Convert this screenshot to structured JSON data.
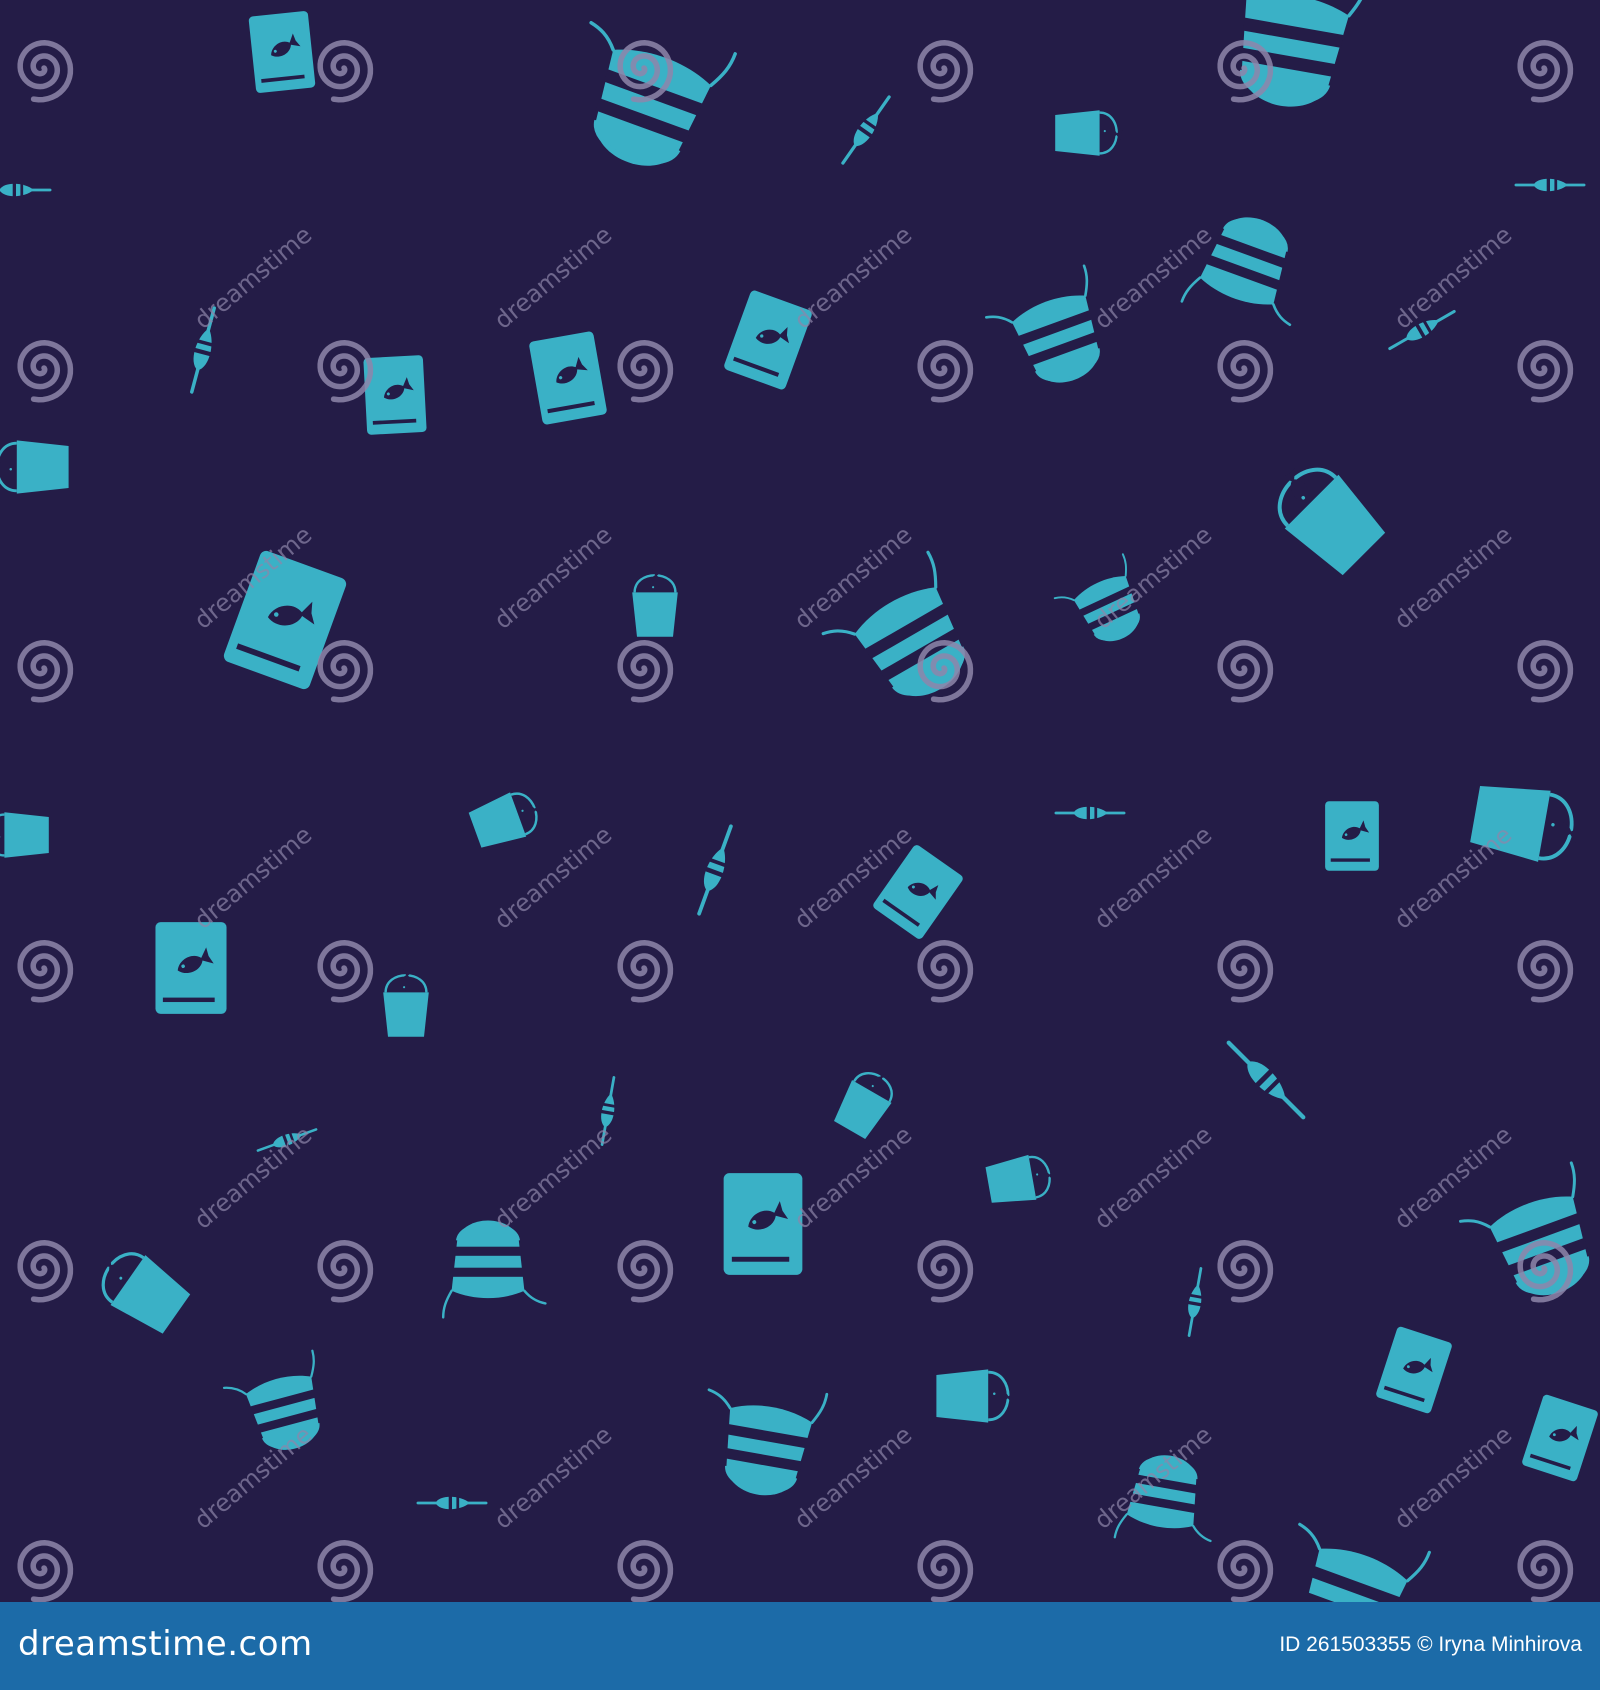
{
  "colors": {
    "background": "#241c47",
    "icon": "#3ab1c6",
    "footer": "#1c6ba8",
    "watermark": "#8e86aa"
  },
  "icons": [
    "fish-card-icon",
    "landing-net-icon",
    "fishing-float-icon",
    "fish-bucket-icon",
    "watermark-spiral-icon"
  ],
  "watermark_text": "dreamstime",
  "footer": {
    "logo": "dreamstime.com",
    "image_id": "ID 261503355",
    "copyright": "© Iryna Minhirova"
  }
}
